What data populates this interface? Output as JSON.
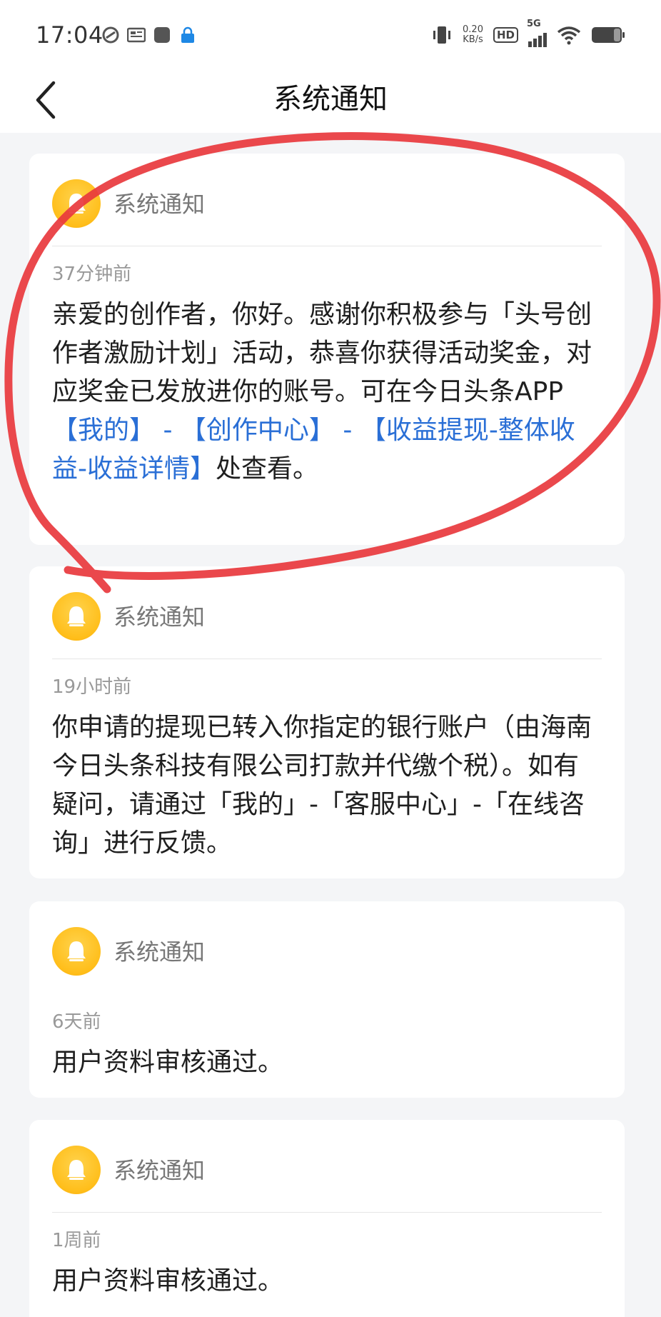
{
  "status_bar": {
    "time": "17:04",
    "net_speed_value": "0.20",
    "net_speed_unit": "KB/s",
    "hd_label": "HD",
    "network_label": "5G"
  },
  "header": {
    "title": "系统通知"
  },
  "notifications": [
    {
      "title": "系统通知",
      "time": "37分钟前",
      "text_1": "亲爱的创作者，你好。感谢你积极参与「头号创作者激励计划」活动，恭喜你获得活动奖金，对应奖金已发放进你的账号。可在今日头条APP",
      "link_1": "【我的】",
      "sep_1": " - ",
      "link_2": "【创作中心】",
      "sep_2": " - ",
      "link_3": "【收益提现-整体收益-收益详情】",
      "text_2": "处查看。"
    },
    {
      "title": "系统通知",
      "time": "19小时前",
      "text": "你申请的提现已转入你指定的银行账户（由海南今日头条科技有限公司打款并代缴个税）。如有疑问，请通过「我的」-「客服中心」-「在线咨询」进行反馈。"
    },
    {
      "title": "系统通知",
      "time": "6天前",
      "text": "用户资料审核通过。"
    },
    {
      "title": "系统通知",
      "time": "1周前",
      "text": "用户资料审核通过。"
    }
  ],
  "colors": {
    "link": "#2a6fd6",
    "bell": "#ffbe1a",
    "marker": "#e8383d"
  },
  "icons": {
    "back": "chevron-left-icon",
    "bell": "bell-icon"
  }
}
